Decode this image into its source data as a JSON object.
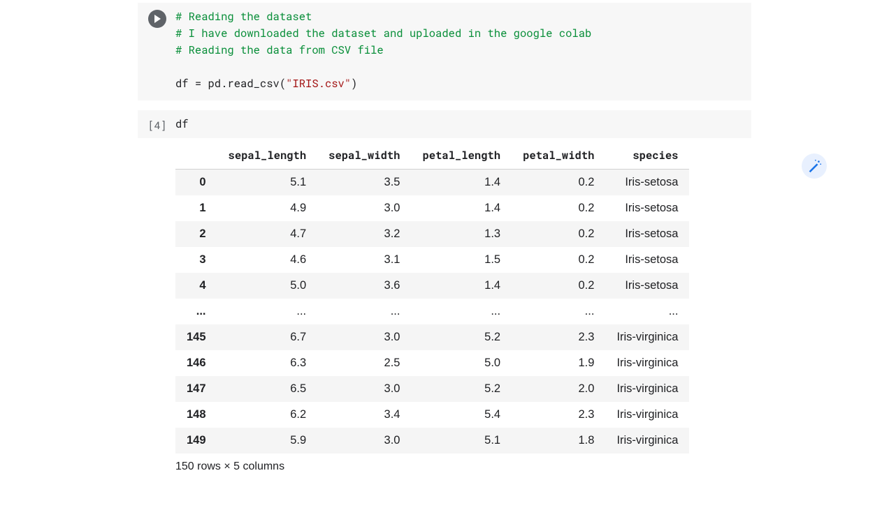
{
  "cells": {
    "code1": {
      "comment1": "# Reading the dataset",
      "comment2": "# I have downloaded the dataset and uploaded in the google colab",
      "comment3": "# Reading the data from CSV file",
      "stmt_prefix": "df = pd.read_csv(",
      "stmt_str": "\"IRIS.csv\"",
      "stmt_suffix": ")"
    },
    "code2": {
      "exec_label": "[4]",
      "code": "df"
    }
  },
  "dataframe": {
    "columns": [
      "sepal_length",
      "sepal_width",
      "petal_length",
      "petal_width",
      "species"
    ],
    "rows": [
      {
        "idx": "0",
        "v": [
          "5.1",
          "3.5",
          "1.4",
          "0.2",
          "Iris-setosa"
        ]
      },
      {
        "idx": "1",
        "v": [
          "4.9",
          "3.0",
          "1.4",
          "0.2",
          "Iris-setosa"
        ]
      },
      {
        "idx": "2",
        "v": [
          "4.7",
          "3.2",
          "1.3",
          "0.2",
          "Iris-setosa"
        ]
      },
      {
        "idx": "3",
        "v": [
          "4.6",
          "3.1",
          "1.5",
          "0.2",
          "Iris-setosa"
        ]
      },
      {
        "idx": "4",
        "v": [
          "5.0",
          "3.6",
          "1.4",
          "0.2",
          "Iris-setosa"
        ]
      },
      {
        "idx": "...",
        "v": [
          "...",
          "...",
          "...",
          "...",
          "..."
        ]
      },
      {
        "idx": "145",
        "v": [
          "6.7",
          "3.0",
          "5.2",
          "2.3",
          "Iris-virginica"
        ]
      },
      {
        "idx": "146",
        "v": [
          "6.3",
          "2.5",
          "5.0",
          "1.9",
          "Iris-virginica"
        ]
      },
      {
        "idx": "147",
        "v": [
          "6.5",
          "3.0",
          "5.2",
          "2.0",
          "Iris-virginica"
        ]
      },
      {
        "idx": "148",
        "v": [
          "6.2",
          "3.4",
          "5.4",
          "2.3",
          "Iris-virginica"
        ]
      },
      {
        "idx": "149",
        "v": [
          "5.9",
          "3.0",
          "5.1",
          "1.8",
          "Iris-virginica"
        ]
      }
    ],
    "summary": "150 rows × 5 columns"
  }
}
